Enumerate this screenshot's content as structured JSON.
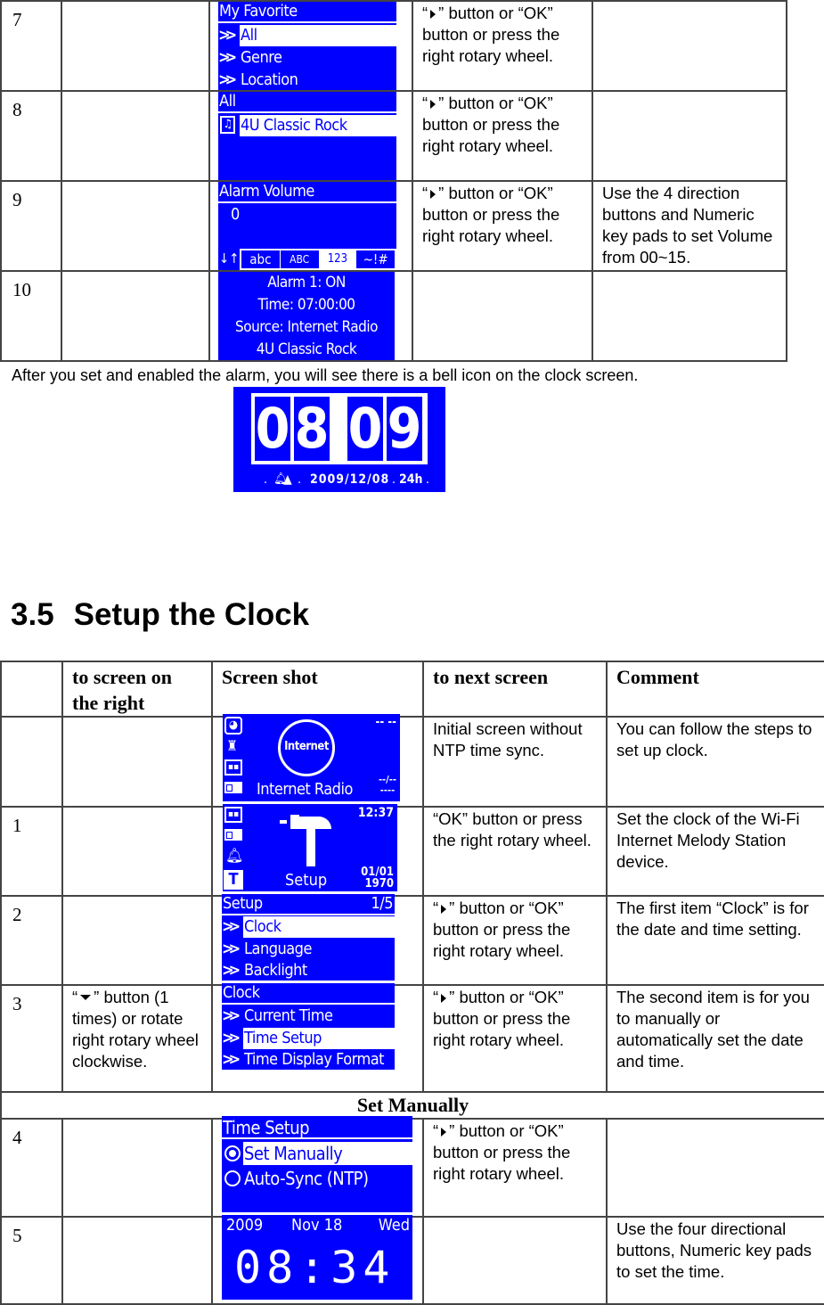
{
  "top_table": {
    "rows": [
      {
        "step": "7",
        "to_screen": "",
        "screen": {
          "title": "My Favorite",
          "items": [
            {
              "label": "All",
              "selected": true
            },
            {
              "label": "Genre",
              "selected": false
            },
            {
              "label": "Location",
              "selected": false
            }
          ]
        },
        "next_pre": "“",
        "next_post": "” button or “OK” button or press the right rotary wheel.",
        "comment": ""
      },
      {
        "step": "8",
        "to_screen": "",
        "screen": {
          "title": "All",
          "items": [
            {
              "label": "4U Classic Rock",
              "selected": true,
              "icon": "music-file-icon"
            }
          ]
        },
        "next_pre": "“",
        "next_post": "” button or “OK” button or press the right rotary wheel.",
        "comment": ""
      },
      {
        "step": "9",
        "to_screen": "",
        "screen": {
          "title": "Alarm Volume",
          "value": "0",
          "input_modes": [
            "abc",
            "ABC",
            "123",
            "~!#"
          ],
          "active_mode": "123"
        },
        "next_pre": "“",
        "next_post": "” button or “OK” button or press the right rotary wheel.",
        "comment": "Use the 4 direction buttons and Numeric key pads to set Volume from 00~15."
      },
      {
        "step": "10",
        "to_screen": "",
        "screen": {
          "lines": [
            "Alarm 1: ON",
            "Time: 07:00:00",
            "Source: Internet Radio",
            "4U Classic Rock"
          ]
        },
        "next": "",
        "comment": ""
      }
    ]
  },
  "alarm_note": "After you set and enabled the alarm, you will see there is a bell icon on the clock screen.",
  "clock_screen": {
    "time": "08:09",
    "status": ".   .  2009/12/08  . 24h .",
    "date": "2009/12/08",
    "format": "24h"
  },
  "section": {
    "number": "3.5",
    "title": "Setup the Clock"
  },
  "clock_table": {
    "headers": [
      "",
      "to screen on the right",
      "Screen shot",
      "to next screen",
      "Comment"
    ],
    "rows": [
      {
        "step": "",
        "to_screen": "",
        "screen": {
          "label": "Internet Radio",
          "center_text": "Internet",
          "time": "-- --",
          "date_top": "--/--",
          "date_bottom": "----"
        },
        "next": "Initial screen without NTP time sync.",
        "comment": "You can follow the steps to set up clock."
      },
      {
        "step": "1",
        "to_screen": "",
        "screen": {
          "label": "Setup",
          "time": "12:37",
          "date_top": "01/01",
          "date_bottom": "1970"
        },
        "next": "“OK” button or press the right rotary wheel.",
        "comment": "Set the clock of the Wi-Fi Internet Melody Station device."
      },
      {
        "step": "2",
        "to_screen": "",
        "screen": {
          "title": "Setup",
          "page": "1/5",
          "items": [
            {
              "label": "Clock",
              "selected": true
            },
            {
              "label": "Language",
              "selected": false
            },
            {
              "label": "Backlight",
              "selected": false
            }
          ]
        },
        "next_pre": "“",
        "next_post": "” button or “OK” button or press the right rotary wheel.",
        "comment": "The first item “Clock” is for the date and time setting."
      },
      {
        "step": "3",
        "to_pre": "“",
        "to_post": "” button (1 times) or rotate right rotary wheel clockwise.",
        "screen": {
          "title": "Clock",
          "items": [
            {
              "label": "Current Time",
              "selected": false
            },
            {
              "label": "Time Setup",
              "selected": true
            },
            {
              "label": "Time Display Format",
              "selected": false
            }
          ]
        },
        "next_pre": "“",
        "next_post": "” button or “OK” button or press the right rotary wheel.",
        "comment": "The second item is for you to manually or automatically set the date and time."
      }
    ],
    "subheader": "Set Manually",
    "rows2": [
      {
        "step": "4",
        "to_screen": "",
        "screen": {
          "title": "Time Setup",
          "options": [
            {
              "label": "Set Manually",
              "selected": true
            },
            {
              "label": "Auto-Sync (NTP)",
              "selected": false
            }
          ]
        },
        "next_pre": "“",
        "next_post": "” button or “OK” button or press the right rotary wheel.",
        "comment": ""
      },
      {
        "step": "5",
        "to_screen": "",
        "screen": {
          "year": "2009",
          "month_day": "Nov 18",
          "weekday": "Wed",
          "time": "08:34"
        },
        "next": "",
        "comment": "Use the four directional buttons, Numeric key pads to set the time."
      }
    ]
  }
}
